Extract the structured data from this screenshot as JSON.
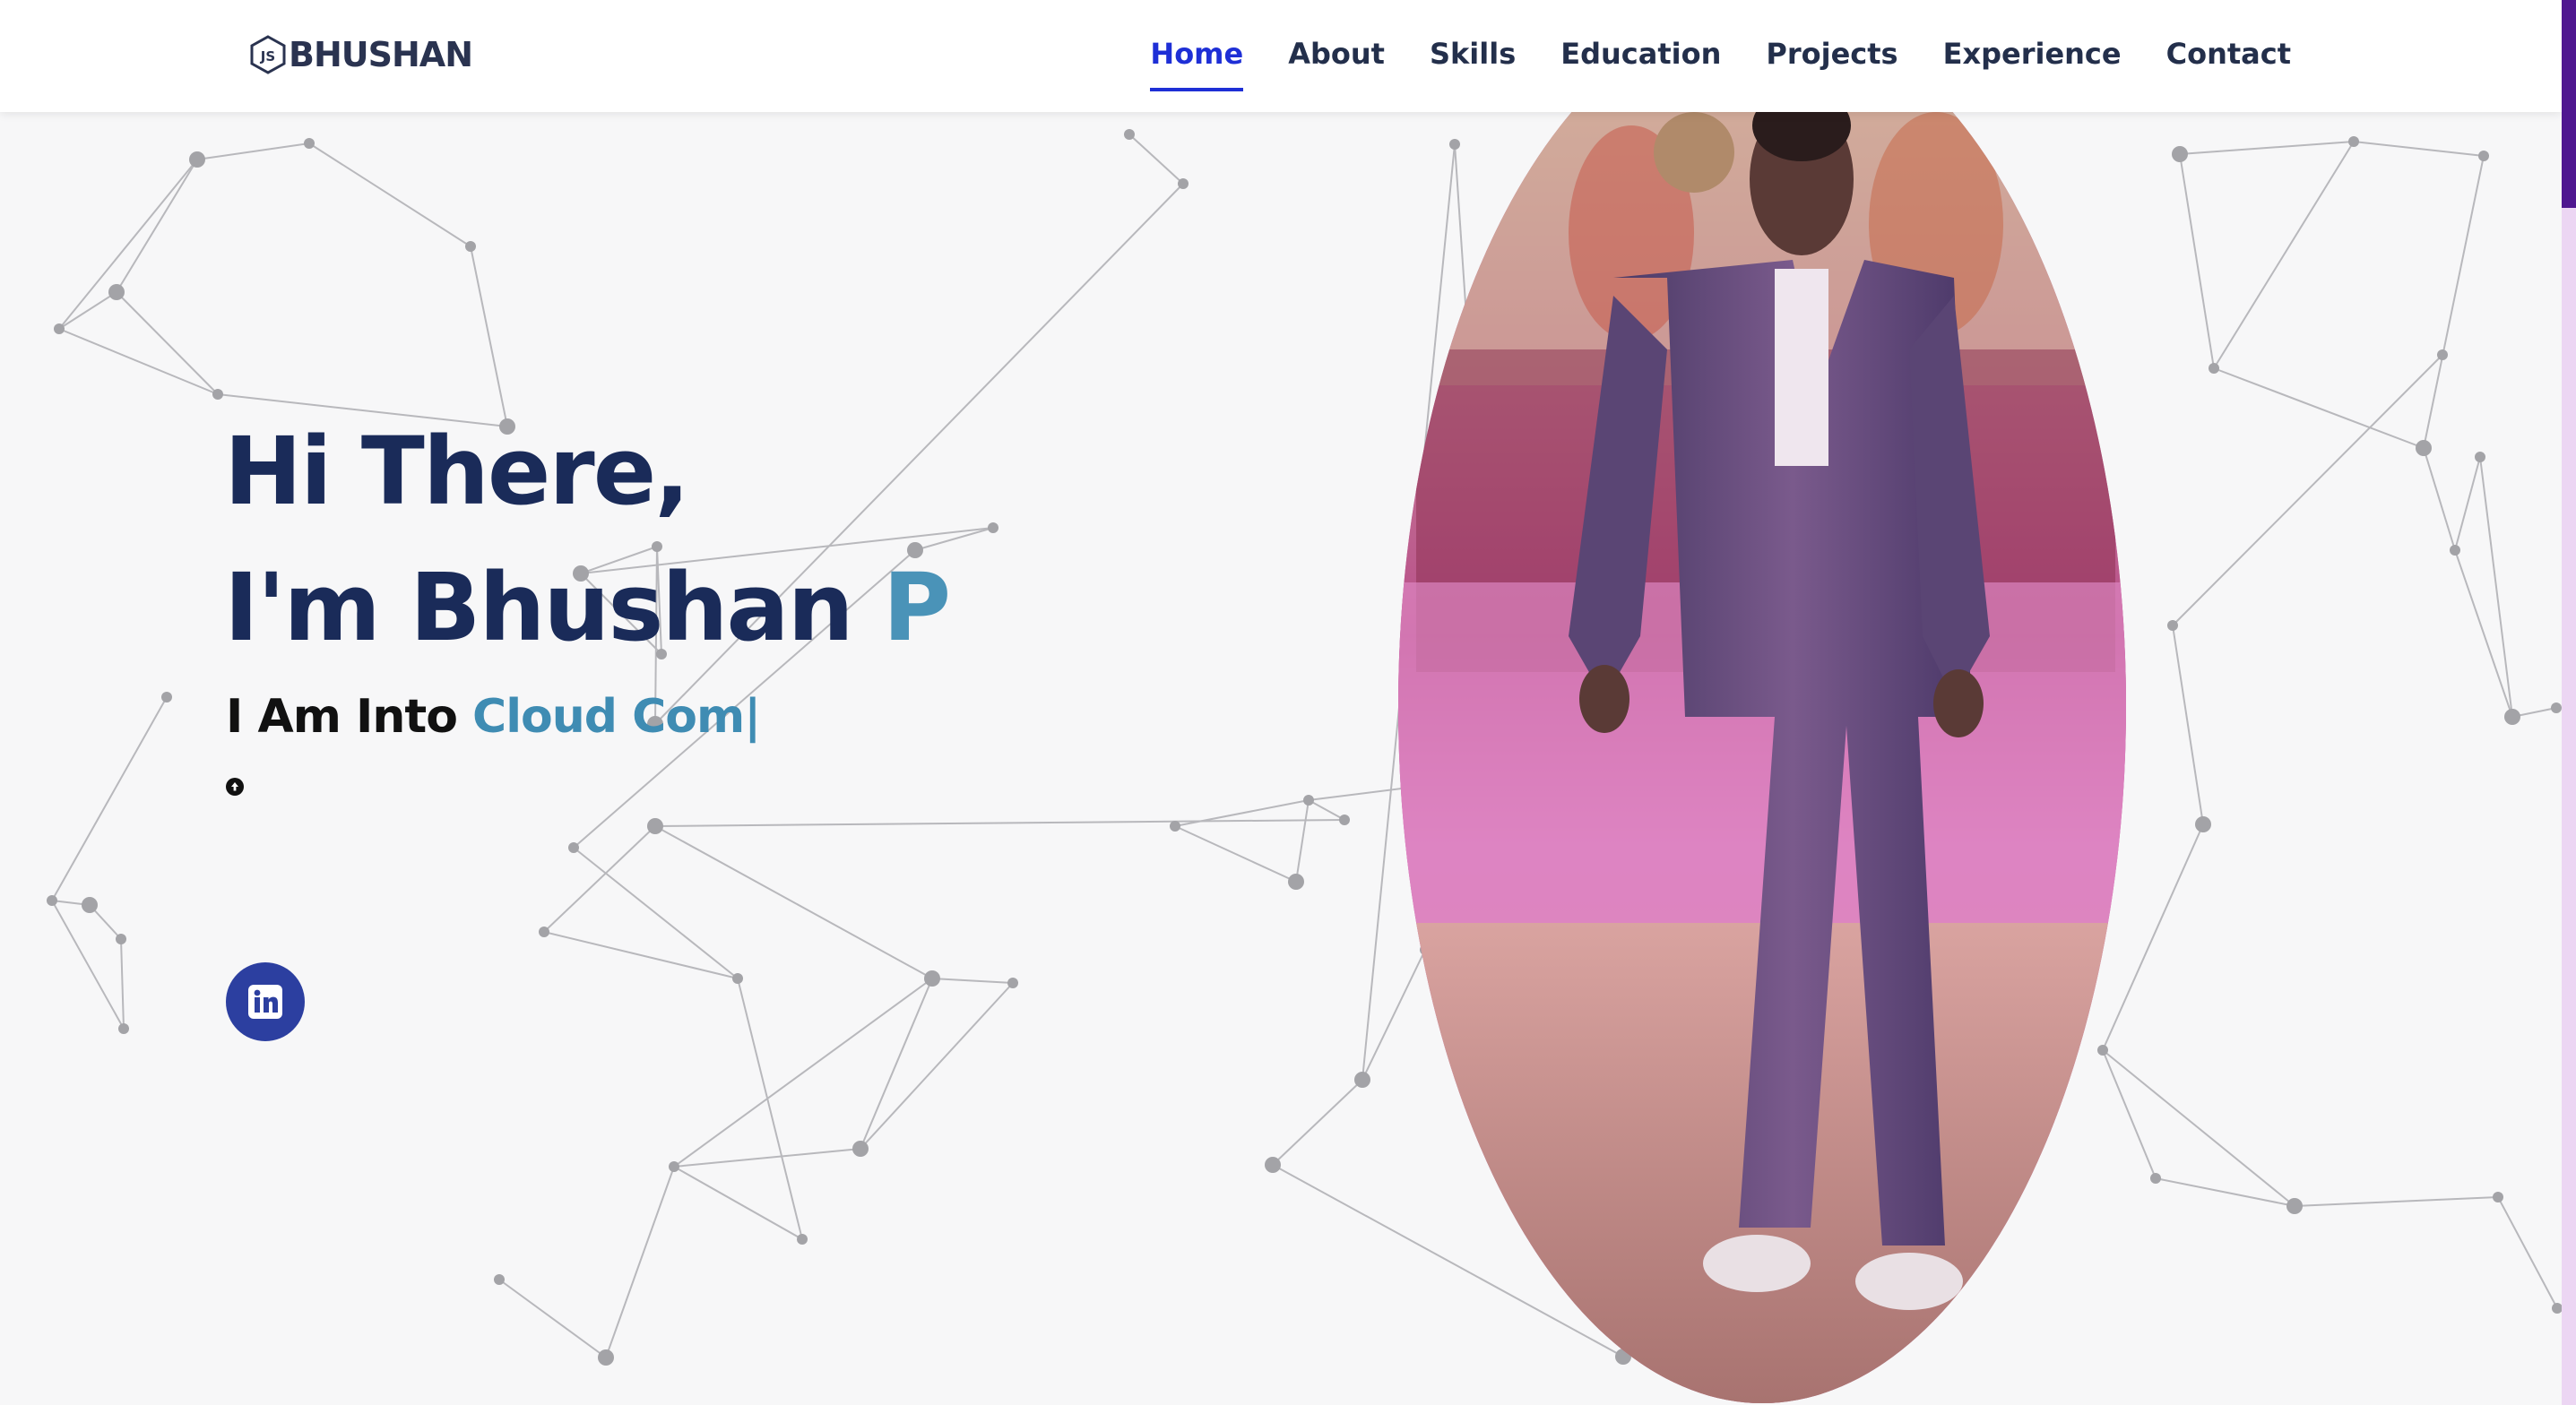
{
  "brand": {
    "icon": "nodejs-hexagon-icon",
    "icon_label": "JS",
    "name": "BHUSHAN"
  },
  "nav": {
    "items": [
      {
        "label": "Home",
        "active": true
      },
      {
        "label": "About"
      },
      {
        "label": "Skills"
      },
      {
        "label": "Education"
      },
      {
        "label": "Projects"
      },
      {
        "label": "Experience"
      },
      {
        "label": "Contact"
      }
    ]
  },
  "hero": {
    "greeting": "Hi There,",
    "intro": "I'm Bhushan ",
    "name_accent": "P",
    "typed_prefix": "I Am Into ",
    "typed_text": "Cloud Com",
    "typed_cursor": "|",
    "small_button_icon": "arrow-up-circle-icon",
    "social_icon": "linkedin-icon"
  },
  "profile_image": {
    "alt": "Profile photo",
    "icon": "profile-photo"
  },
  "colors": {
    "nav_active": "#1e2fd6",
    "heading": "#1a2b59",
    "accent": "#4a93b8",
    "linkedin": "#2c3fa0",
    "scrollbar_thumb": "#4f1790",
    "scrollbar_track": "#ecd6f3"
  }
}
